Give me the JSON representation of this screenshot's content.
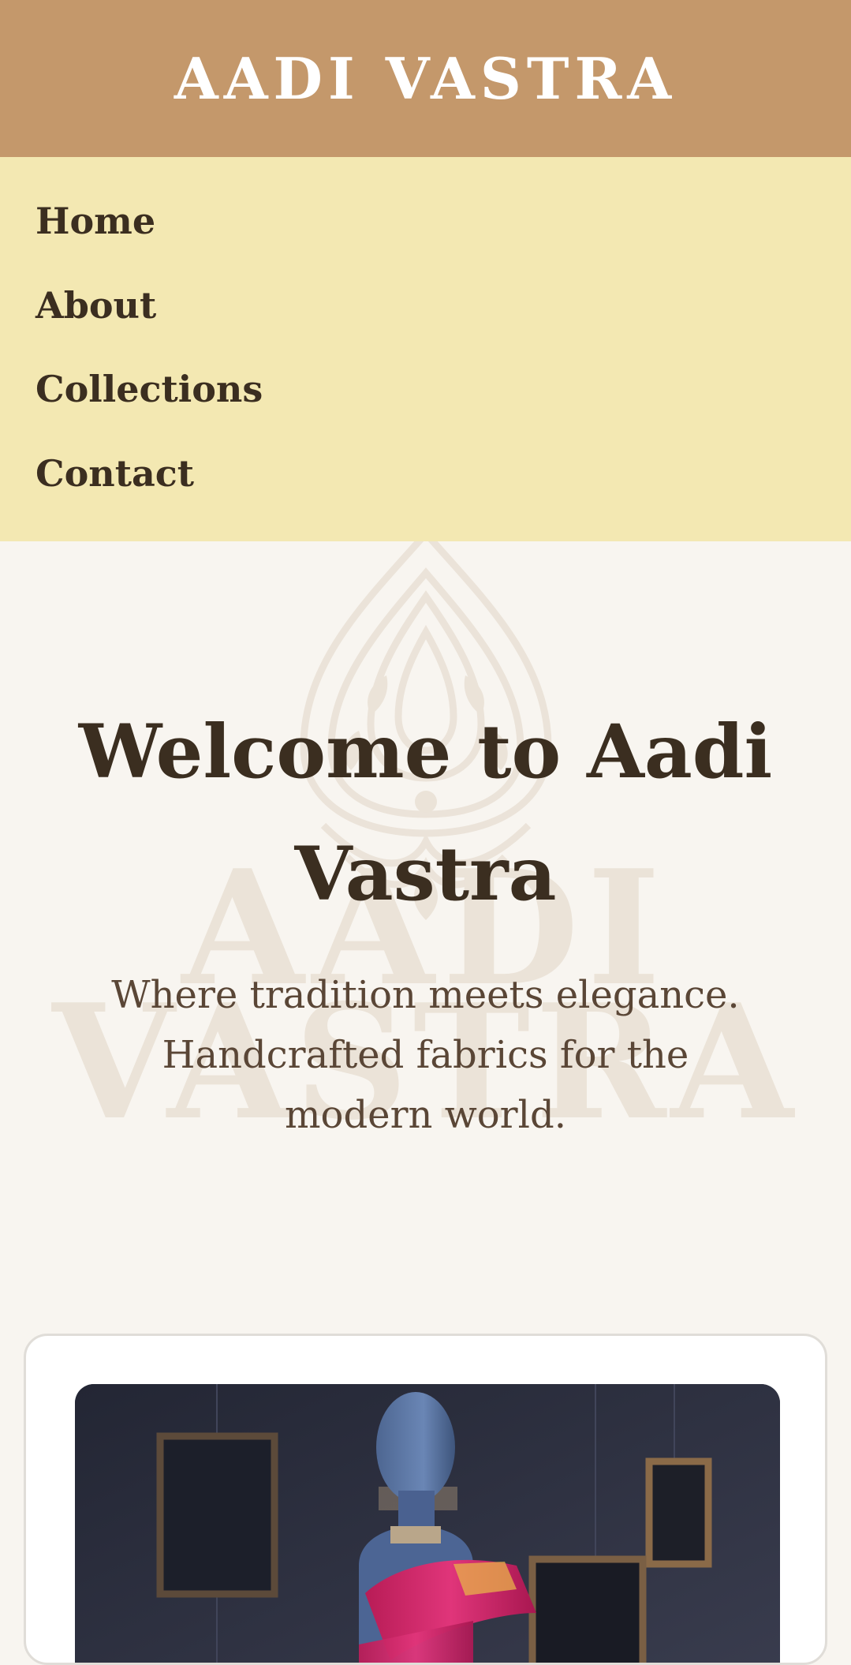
{
  "header": {
    "brand": "AADI VASTRA"
  },
  "nav": {
    "items": [
      {
        "label": "Home"
      },
      {
        "label": "About"
      },
      {
        "label": "Collections"
      },
      {
        "label": "Contact"
      }
    ]
  },
  "hero": {
    "title": "Welcome to Aadi Vastra",
    "subtitle": "Where tradition meets elegance. Handcrafted fabrics for the modern world.",
    "watermark_text_line1": "AADI",
    "watermark_text_line2": "VASTRA"
  },
  "colors": {
    "header_bg": "#c4986b",
    "nav_bg": "#f3e8b2",
    "page_bg": "#f8f5f0",
    "text_dark": "#3b2e20",
    "accent_pink": "#d62a6d"
  },
  "icons": {
    "watermark": "paisley-logo-icon"
  }
}
